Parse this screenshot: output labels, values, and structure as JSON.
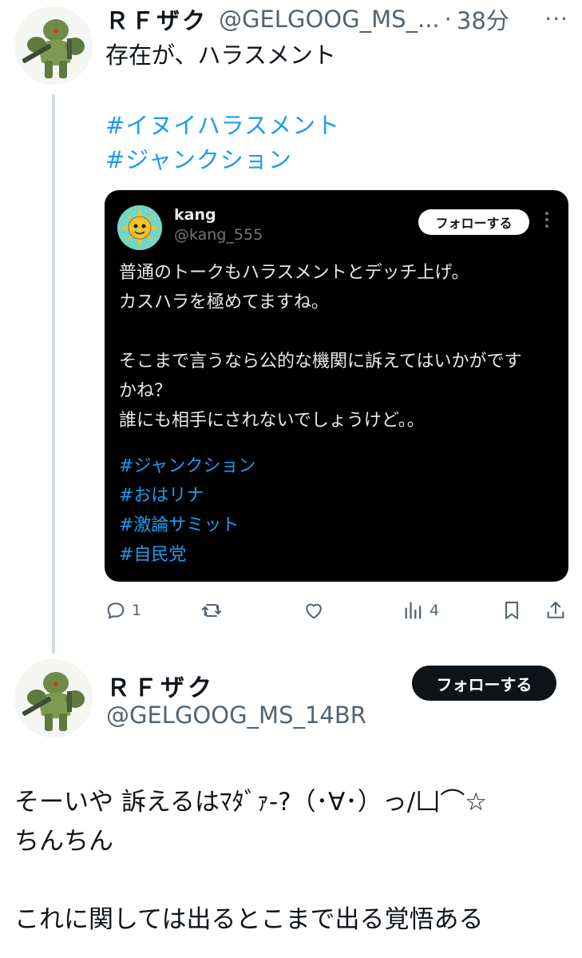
{
  "tweet1": {
    "display_name": "ＲＦザク",
    "handle": "@GELGOOG_MS_...",
    "dot": "·",
    "time": "38分",
    "more": "···",
    "text": "存在が、ハラスメント",
    "hashtags": [
      "#イヌイハラスメント",
      "#ジャンクション"
    ]
  },
  "quoted": {
    "display_name": "kang",
    "handle": "@kang_555",
    "follow_label": "フォローする",
    "more": "⋮",
    "body_lines": [
      "普通のトークもハラスメントとデッチ上げ。",
      "カスハラを極めてますね。",
      "",
      "そこまで言うなら公的な機関に訴えてはいかがです",
      "かね？",
      "誰にも相手にされないでしょうけど。。"
    ],
    "hashtags": [
      "#ジャンクション",
      "#おはリナ",
      "#激論サミット",
      "#自民党"
    ]
  },
  "actions": {
    "reply_count": "1",
    "retweet_count": "",
    "like_count": "",
    "views_count": "4"
  },
  "tweet2": {
    "display_name": "ＲＦザク",
    "handle": "@GELGOOG_MS_14BR",
    "follow_label": "フォローする",
    "body_lines": [
      "そーいや 訴えるはﾏﾀﾞｧ-?（･∀･）っ/凵⌒☆",
      "ちんちん",
      "",
      "これに関しては出るとこまで出る覚悟ある"
    ]
  },
  "colors": {
    "link": "#1d9bf0",
    "muted": "#536471",
    "card_bg": "#000000",
    "thread_line": "#cfd9de"
  }
}
